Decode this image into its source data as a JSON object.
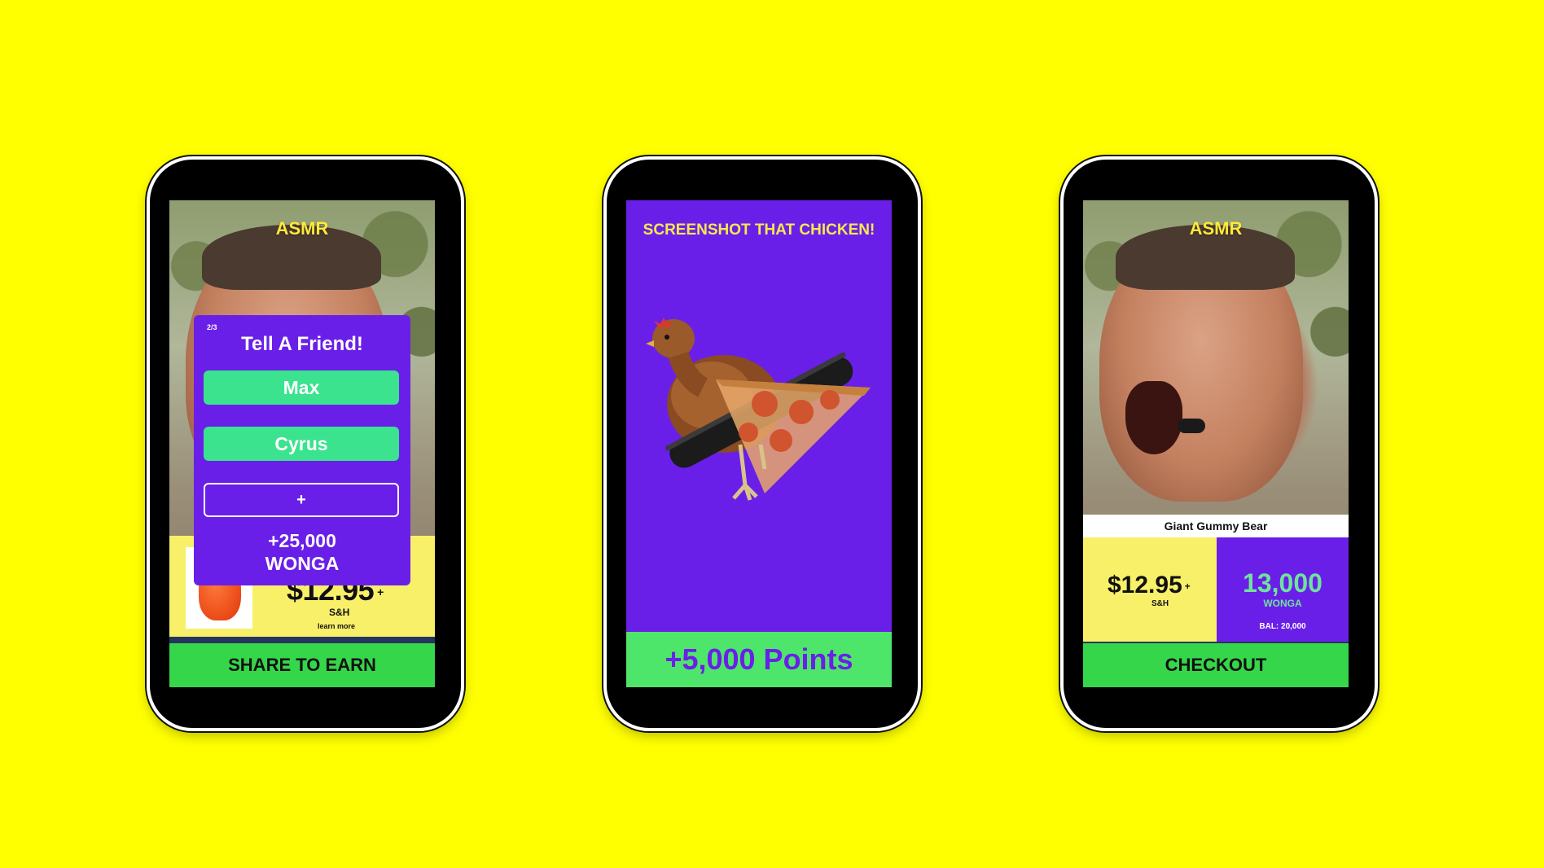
{
  "colors": {
    "background": "#ffff00",
    "purple": "#6a1fe9",
    "green": "#35d64a",
    "mint": "#3be38e",
    "yellow_band": "#f9f06a",
    "headline_yellow": "#ffe93a"
  },
  "phone1": {
    "label": "ASMR",
    "modal": {
      "step": "2/3",
      "title": "Tell A Friend!",
      "friends": [
        "Max",
        "Cyrus"
      ],
      "add_label": "+",
      "reward_amount": "+25,000",
      "reward_unit": "WONGA"
    },
    "price": "$12.95",
    "price_plus": "+",
    "shipping": "S&H",
    "learn_more": "learn more",
    "cta": "SHARE TO EARN"
  },
  "phone2": {
    "title": "SCREENSHOT THAT CHICKEN!",
    "points": "+5,000 Points"
  },
  "phone3": {
    "label": "ASMR",
    "product": "Giant Gummy Bear",
    "price": "$12.95",
    "price_plus": "+",
    "shipping": "S&H",
    "wonga_amount": "13,000",
    "wonga_label": "WONGA",
    "balance": "BAL: 20,000",
    "cta": "CHECKOUT"
  }
}
